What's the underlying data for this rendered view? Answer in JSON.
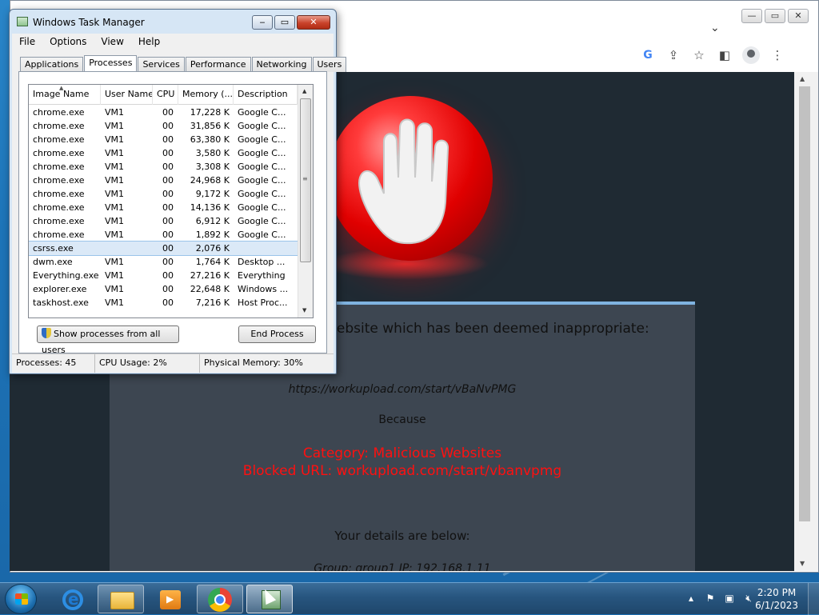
{
  "browser": {
    "toolbar_icons": [
      "google-icon",
      "share-icon",
      "star-icon",
      "sidepanel-icon",
      "profile-icon",
      "menu-icon"
    ]
  },
  "block_page": {
    "headline": "website which has been deemed inappropriate:",
    "url": "https://workupload.com/start/vBaNvPMG",
    "because": "Because",
    "category": "Category: Malicious Websites",
    "blocked_url": "Blocked URL: workupload.com/start/vbanvpmg",
    "details_heading": "Your details are below:",
    "group_line": "Group: group1   IP: 192.168.1.11",
    "colors": {
      "alert_red": "#ff1010",
      "panel": "#3d4651",
      "page_bg": "#1f2a33"
    }
  },
  "task_manager": {
    "title": "Windows Task Manager",
    "menu": [
      "File",
      "Options",
      "View",
      "Help"
    ],
    "tabs": [
      "Applications",
      "Processes",
      "Services",
      "Performance",
      "Networking",
      "Users"
    ],
    "active_tab": "Processes",
    "columns": [
      "Image Name",
      "User Name",
      "CPU",
      "Memory (...",
      "Description"
    ],
    "rows": [
      {
        "image": "chrome.exe",
        "user": "VM1",
        "cpu": "00",
        "mem": "17,228 K",
        "desc": "Google C..."
      },
      {
        "image": "chrome.exe",
        "user": "VM1",
        "cpu": "00",
        "mem": "31,856 K",
        "desc": "Google C..."
      },
      {
        "image": "chrome.exe",
        "user": "VM1",
        "cpu": "00",
        "mem": "63,380 K",
        "desc": "Google C..."
      },
      {
        "image": "chrome.exe",
        "user": "VM1",
        "cpu": "00",
        "mem": "3,580 K",
        "desc": "Google C..."
      },
      {
        "image": "chrome.exe",
        "user": "VM1",
        "cpu": "00",
        "mem": "3,308 K",
        "desc": "Google C..."
      },
      {
        "image": "chrome.exe",
        "user": "VM1",
        "cpu": "00",
        "mem": "24,968 K",
        "desc": "Google C..."
      },
      {
        "image": "chrome.exe",
        "user": "VM1",
        "cpu": "00",
        "mem": "9,172 K",
        "desc": "Google C..."
      },
      {
        "image": "chrome.exe",
        "user": "VM1",
        "cpu": "00",
        "mem": "14,136 K",
        "desc": "Google C..."
      },
      {
        "image": "chrome.exe",
        "user": "VM1",
        "cpu": "00",
        "mem": "6,912 K",
        "desc": "Google C..."
      },
      {
        "image": "chrome.exe",
        "user": "VM1",
        "cpu": "00",
        "mem": "1,892 K",
        "desc": "Google C..."
      },
      {
        "image": "csrss.exe",
        "user": "",
        "cpu": "00",
        "mem": "2,076 K",
        "desc": "",
        "selected": true
      },
      {
        "image": "dwm.exe",
        "user": "VM1",
        "cpu": "00",
        "mem": "1,764 K",
        "desc": "Desktop ..."
      },
      {
        "image": "Everything.exe",
        "user": "VM1",
        "cpu": "00",
        "mem": "27,216 K",
        "desc": "Everything"
      },
      {
        "image": "explorer.exe",
        "user": "VM1",
        "cpu": "00",
        "mem": "22,648 K",
        "desc": "Windows ..."
      },
      {
        "image": "taskhost.exe",
        "user": "VM1",
        "cpu": "00",
        "mem": "7,216 K",
        "desc": "Host Proc..."
      }
    ],
    "show_all_label": "Show processes from all users",
    "end_process_label": "End Process",
    "status": {
      "processes": "Processes: 45",
      "cpu": "CPU Usage: 2%",
      "memory": "Physical Memory: 30%"
    }
  },
  "taskbar": {
    "items": [
      "start-orb",
      "internet-explorer",
      "windows-explorer",
      "media-center",
      "google-chrome",
      "task-manager"
    ],
    "time": "2:20 PM",
    "date": "6/1/2023"
  }
}
